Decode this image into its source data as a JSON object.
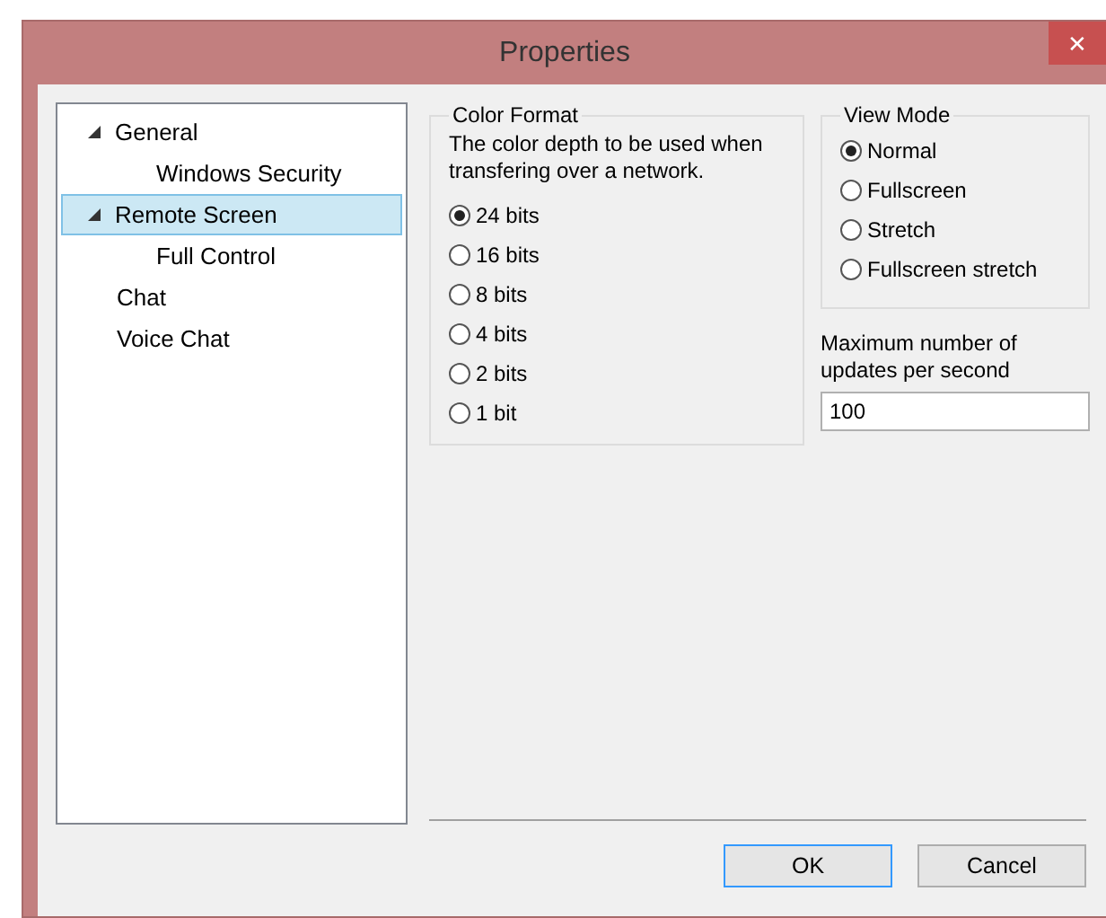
{
  "window": {
    "title": "Properties",
    "close": "✕"
  },
  "tree": [
    {
      "label": "General",
      "expanded": true,
      "selected": false,
      "children": [
        {
          "label": "Windows Security",
          "selected": false
        }
      ]
    },
    {
      "label": "Remote Screen",
      "expanded": true,
      "selected": true,
      "children": [
        {
          "label": "Full Control",
          "selected": false
        }
      ]
    },
    {
      "label": "Chat",
      "selected": false
    },
    {
      "label": "Voice Chat",
      "selected": false
    }
  ],
  "color_format": {
    "title": "Color Format",
    "description": "The color depth to be used when transfering over a network.",
    "options": [
      {
        "label": "24 bits",
        "selected": true
      },
      {
        "label": "16 bits",
        "selected": false
      },
      {
        "label": "8 bits",
        "selected": false
      },
      {
        "label": "4 bits",
        "selected": false
      },
      {
        "label": "2 bits",
        "selected": false
      },
      {
        "label": "1 bit",
        "selected": false
      }
    ]
  },
  "view_mode": {
    "title": "View Mode",
    "options": [
      {
        "label": "Normal",
        "selected": true
      },
      {
        "label": "Fullscreen",
        "selected": false
      },
      {
        "label": "Stretch",
        "selected": false
      },
      {
        "label": "Fullscreen stretch",
        "selected": false
      }
    ]
  },
  "updates": {
    "label": "Maximum number of updates per second",
    "value": "100"
  },
  "buttons": [
    {
      "label": "OK",
      "default": true
    },
    {
      "label": "Cancel",
      "default": false
    }
  ]
}
